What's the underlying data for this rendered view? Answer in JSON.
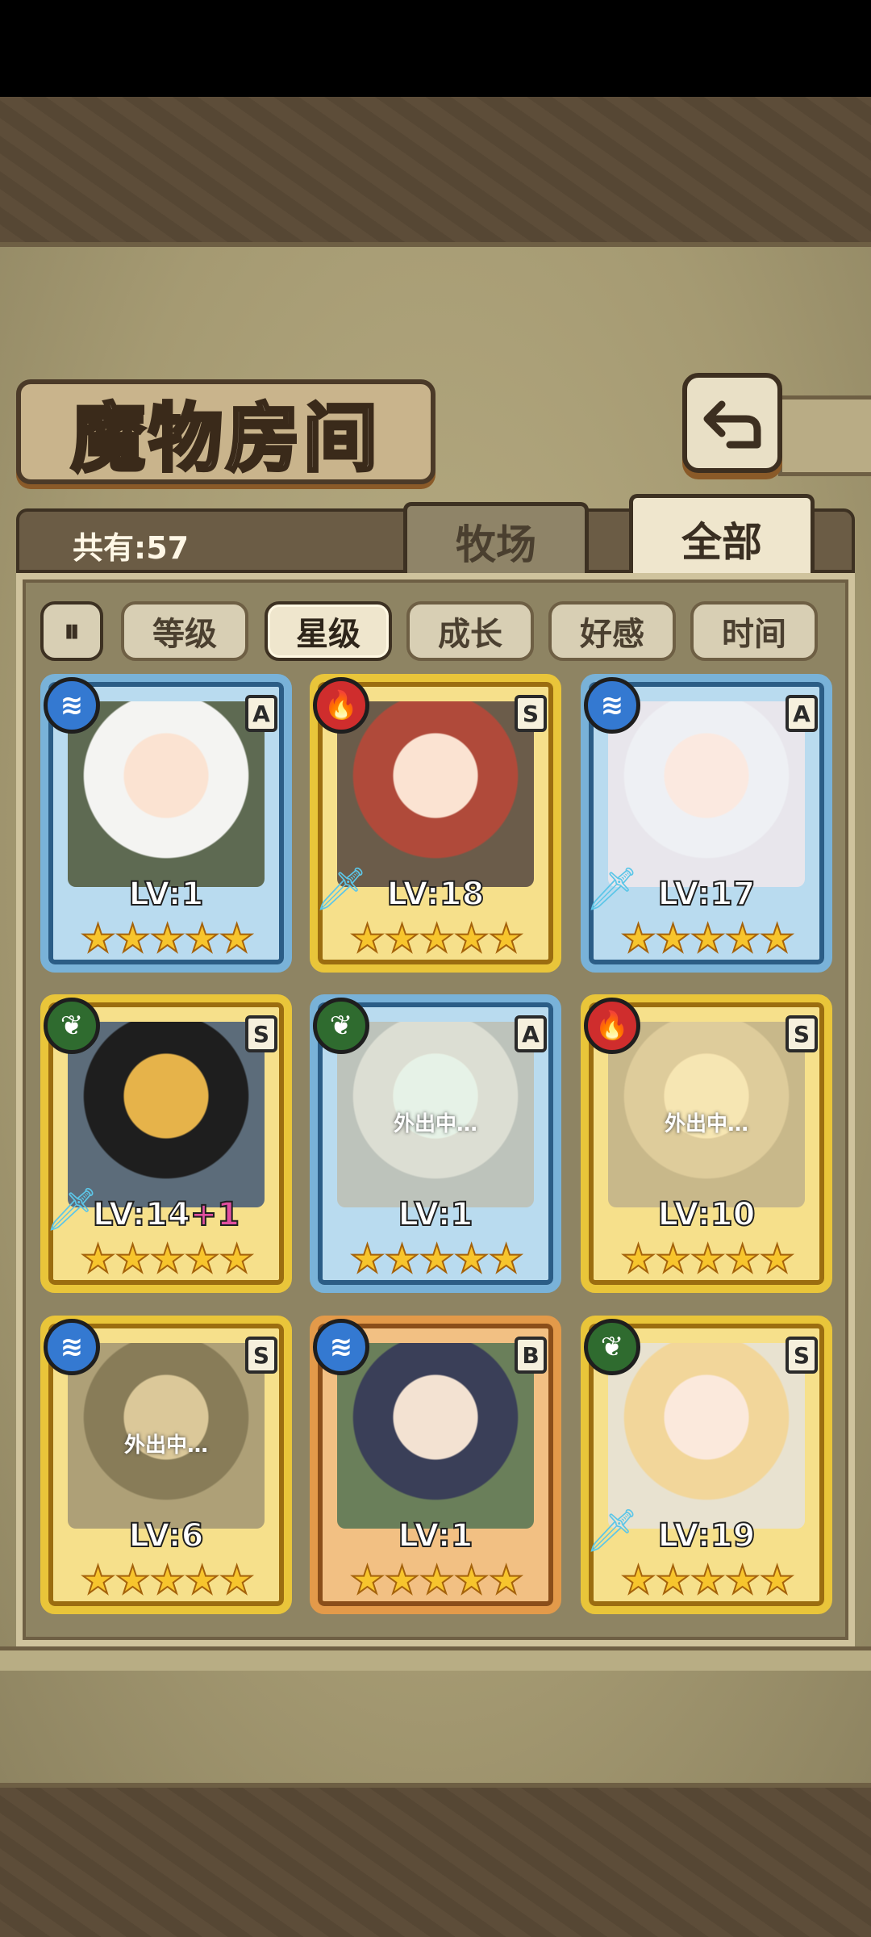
{
  "header": {
    "title": "魔物房间",
    "count_label": "共有:57"
  },
  "tabs": [
    {
      "label": "牧场"
    },
    {
      "label": "全部"
    }
  ],
  "sort": {
    "toggle_label": "⏸",
    "buttons": [
      {
        "label": "等级"
      },
      {
        "label": "星级"
      },
      {
        "label": "成长"
      },
      {
        "label": "好感"
      },
      {
        "label": "时间"
      }
    ],
    "active": "星级"
  },
  "cards": [
    {
      "element": "water",
      "element_icon": "≋",
      "rank": "A",
      "level": "LV:1",
      "plus": "",
      "weapon": false,
      "away": false,
      "away_text": "",
      "stars": 5
    },
    {
      "element": "fire",
      "element_icon": "🔥",
      "rank": "S",
      "level": "LV:18",
      "plus": "",
      "weapon": true,
      "away": false,
      "away_text": "",
      "stars": 5
    },
    {
      "element": "water",
      "element_icon": "≋",
      "rank": "A",
      "level": "LV:17",
      "plus": "",
      "weapon": true,
      "away": false,
      "away_text": "",
      "stars": 5
    },
    {
      "element": "wood",
      "element_icon": "❦",
      "rank": "S",
      "level": "LV:14",
      "plus": "+1",
      "weapon": true,
      "away": false,
      "away_text": "",
      "stars": 5
    },
    {
      "element": "wood",
      "element_icon": "❦",
      "rank": "A",
      "level": "LV:1",
      "plus": "",
      "weapon": false,
      "away": true,
      "away_text": "外出中…",
      "stars": 5
    },
    {
      "element": "fire",
      "element_icon": "🔥",
      "rank": "S",
      "level": "LV:10",
      "plus": "",
      "weapon": false,
      "away": true,
      "away_text": "外出中…",
      "stars": 5
    },
    {
      "element": "water",
      "element_icon": "≋",
      "rank": "S",
      "level": "LV:6",
      "plus": "",
      "weapon": false,
      "away": true,
      "away_text": "外出中…",
      "stars": 5
    },
    {
      "element": "water",
      "element_icon": "≋",
      "rank": "B",
      "level": "LV:1",
      "plus": "",
      "weapon": false,
      "away": false,
      "away_text": "",
      "stars": 5
    },
    {
      "element": "wood",
      "element_icon": "❦",
      "rank": "S",
      "level": "LV:19",
      "plus": "",
      "weapon": true,
      "away": false,
      "away_text": "",
      "stars": 5
    }
  ]
}
